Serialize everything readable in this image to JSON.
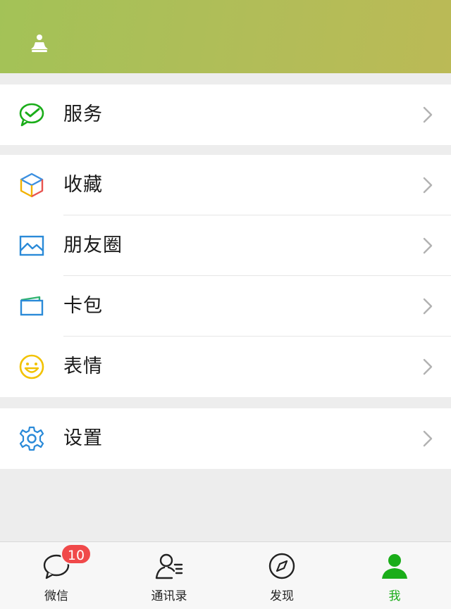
{
  "header": {
    "icon": "meditation-icon"
  },
  "groups": [
    {
      "items": [
        {
          "label": "服务",
          "icon": "wechat-pay-icon"
        }
      ]
    },
    {
      "items": [
        {
          "label": "收藏",
          "icon": "favorites-cube-icon"
        },
        {
          "label": "朋友圈",
          "icon": "moments-picture-icon"
        },
        {
          "label": "卡包",
          "icon": "card-wallet-icon"
        },
        {
          "label": "表情",
          "icon": "smiley-icon"
        }
      ]
    },
    {
      "items": [
        {
          "label": "设置",
          "icon": "settings-gear-icon"
        }
      ]
    }
  ],
  "tabbar": {
    "tabs": [
      {
        "label": "微信",
        "icon": "chat-bubble-icon",
        "badge": "10"
      },
      {
        "label": "通讯录",
        "icon": "contacts-icon"
      },
      {
        "label": "发现",
        "icon": "compass-icon"
      },
      {
        "label": "我",
        "icon": "profile-icon",
        "active": true
      }
    ]
  },
  "colors": {
    "accent": "#1aad19",
    "badge": "#f0494a",
    "header_start": "#a3c257",
    "header_end": "#bbba56"
  }
}
